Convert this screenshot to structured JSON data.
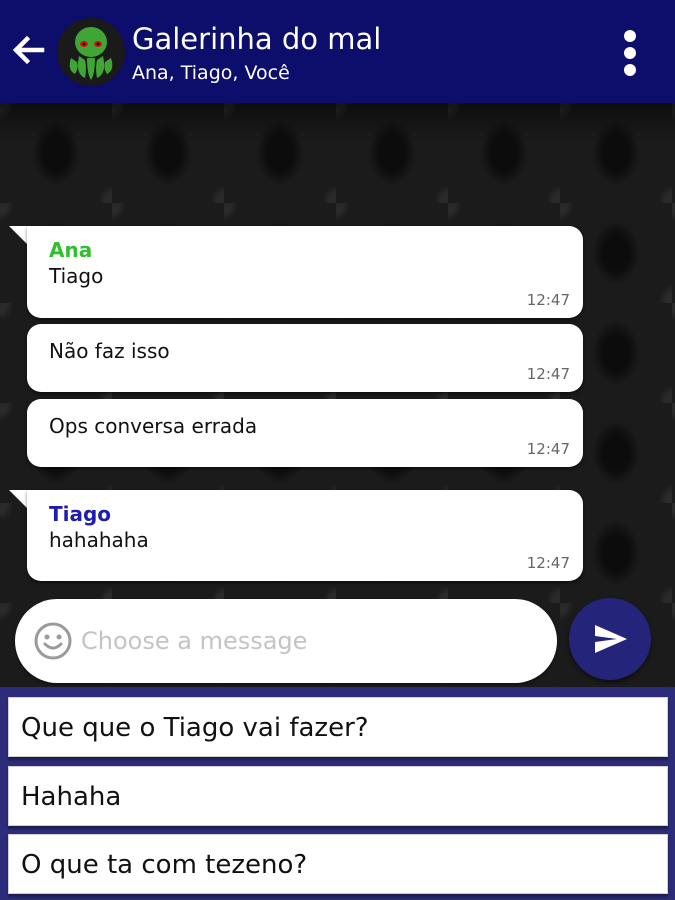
{
  "header": {
    "title": "Galerinha do mal",
    "participants": "Ana, Tiago, Você",
    "back_icon": "arrow-left-icon",
    "menu_icon": "more-vertical-icon",
    "avatar_icon": "octopus-avatar",
    "background_color": "#0d0d6b"
  },
  "messages": [
    {
      "sender": "Ana",
      "sender_color": "#2ec12e",
      "text": "Tiago",
      "time": "12:47"
    },
    {
      "text": "Não faz isso",
      "time": "12:47"
    },
    {
      "text": "Ops conversa errada",
      "time": "12:47"
    },
    {
      "sender": "Tiago",
      "sender_color": "#1d1db0",
      "text": "hahahaha",
      "time": "12:47"
    }
  ],
  "composer": {
    "placeholder": "Choose a message",
    "value": "",
    "emoji_icon": "smiley-icon",
    "send_icon": "send-icon"
  },
  "suggestions": [
    "Que que o Tiago vai fazer?",
    "Hahaha",
    "O que ta com tezeno?"
  ],
  "colors": {
    "accent": "#24247a",
    "suggestion_panel": "#2c2c7a"
  }
}
